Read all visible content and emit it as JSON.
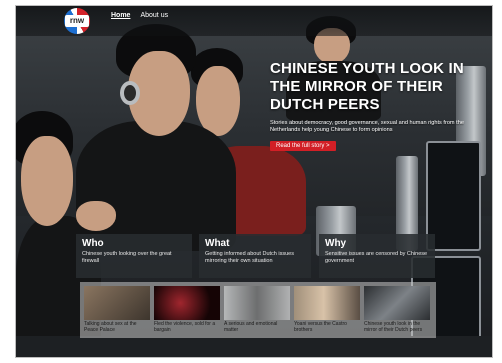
{
  "nav": {
    "logo_text": "rnw",
    "items": [
      {
        "label": "Home"
      },
      {
        "label": "About us"
      }
    ]
  },
  "hero": {
    "title": "CHINESE YOUTH LOOK IN THE MIRROR OF THEIR DUTCH PEERS",
    "description": "Stories about democracy, good governance, sexual and human rights from the Netherlands help young Chinese to form opinions",
    "cta": "Read the full story >"
  },
  "info_boxes": [
    {
      "title": "Who",
      "text": "Chinese youth looking over the great firewall"
    },
    {
      "title": "What",
      "text": "Getting informed about Dutch issues mirroring their own situation"
    },
    {
      "title": "Why",
      "text": "Sensitive issues are censored by Chinese government"
    }
  ],
  "videos": [
    {
      "caption": "Talking about sex at the Peace Palace",
      "color": "#6b5a48"
    },
    {
      "caption": "Fled the violence, sold for a bargain",
      "color": "#3a0d10"
    },
    {
      "caption": "A serious and emotional matter",
      "color": "#8d8f90"
    },
    {
      "caption": "Yoani versus the Castro brothers",
      "color": "#7d6f62"
    },
    {
      "caption": "Chinese youth look in the mirror of their Dutch peers",
      "color": "#505458"
    }
  ],
  "colors": {
    "accent_red": "#d21f26",
    "logo_blue": "#1d6fd1"
  }
}
